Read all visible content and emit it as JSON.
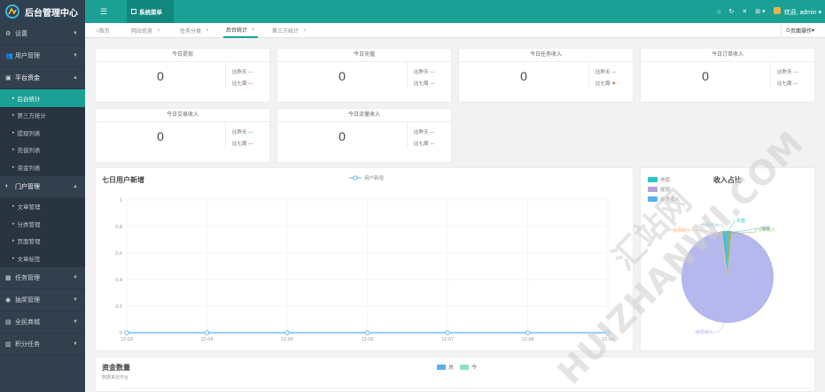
{
  "app_title": "后台管理中心",
  "topbar": {
    "menu_icon": "menu-icon",
    "system_menu": "系统菜单",
    "welcome": "欢迎, admin",
    "right_icons": [
      "home-icon",
      "refresh-icon",
      "fullscreen-icon",
      "grid-icon"
    ]
  },
  "sidebar": {
    "groups": [
      {
        "label": "设置",
        "icon": "settings-icon"
      },
      {
        "label": "用户管理",
        "icon": "users-icon"
      },
      {
        "label": "平台资金",
        "icon": "bank-icon",
        "open": true,
        "items": [
          "后台统计",
          "第三方统计",
          "提现列表",
          "充值列表",
          "资金列表"
        ]
      },
      {
        "label": "门户管理",
        "icon": "portal-icon",
        "open": true,
        "items": [
          "文章管理",
          "分类管理",
          "页面管理",
          "文章标签"
        ]
      },
      {
        "label": "任务管理",
        "icon": "task-icon"
      },
      {
        "label": "抽奖管理",
        "icon": "lottery-icon"
      },
      {
        "label": "全民商城",
        "icon": "mall-icon"
      },
      {
        "label": "积分任务",
        "icon": "points-icon"
      }
    ]
  },
  "tabs": [
    {
      "label": "首页",
      "closable": false
    },
    {
      "label": "网站信息",
      "closable": true
    },
    {
      "label": "任务分类",
      "closable": true
    },
    {
      "label": "后台统计",
      "closable": true,
      "active": true
    },
    {
      "label": "第三方统计",
      "closable": true
    }
  ],
  "page_ops": "页面操作",
  "compare": {
    "prev_day": "比昨天",
    "prev_week": "比七周"
  },
  "stat_cards": [
    {
      "title": "今日提现",
      "value": "0",
      "d1": "—",
      "d2": "—",
      "d2_arrow": ""
    },
    {
      "title": "今日充值",
      "value": "0",
      "d1": "—",
      "d2": "—",
      "d2_arrow": ""
    },
    {
      "title": "今日任务收入",
      "value": "0",
      "d1": "—",
      "d2": "▼",
      "d2_arrow": "▼"
    },
    {
      "title": "今日订单收入",
      "value": "0",
      "d1": "—",
      "d2": "—",
      "d2_arrow": ""
    },
    {
      "title": "今日交易收入",
      "value": "0",
      "d1": "—",
      "d2": "—",
      "d2_arrow": ""
    },
    {
      "title": "今日流量收入",
      "value": "0",
      "d1": "—",
      "d2": "—",
      "d2_arrow": ""
    }
  ],
  "line_panel": {
    "title": "七日用户新增",
    "legend": "用户新增"
  },
  "pie_panel": {
    "title": "收入占比",
    "legend": [
      "充值",
      "提现",
      "会员收入"
    ]
  },
  "funds_panel": {
    "title": "资金数量",
    "subtitle": "数据来自平台",
    "legend": [
      "总",
      "今"
    ]
  },
  "watermark": {
    "line1": "汇站网",
    "line2": "HUIZHANWI.COM"
  },
  "chart_data": [
    {
      "type": "line",
      "x": [
        "12-03",
        "12-04",
        "12-05",
        "12-06",
        "12-07",
        "12-08",
        "12-09"
      ],
      "series": [
        {
          "name": "用户新增",
          "values": [
            0,
            0,
            0,
            0,
            0,
            0,
            0
          ]
        }
      ],
      "ylim": [
        0,
        1
      ],
      "yticks": [
        "0",
        "0.2",
        "0.4",
        "0.6",
        "0.8",
        "1"
      ],
      "grid": true,
      "legend": "top-center"
    },
    {
      "type": "pie",
      "title": "收入占比",
      "slices": [
        {
          "label": "会员收入",
          "value": 97
        },
        {
          "label": "充值",
          "value": 1
        },
        {
          "label": "提现",
          "value": 1
        },
        {
          "label": "订单收入",
          "value": 1
        },
        {
          "label": "任务收入",
          "value": 0
        },
        {
          "label": "会员收入",
          "value": 0
        }
      ],
      "legend": "top-left"
    }
  ]
}
